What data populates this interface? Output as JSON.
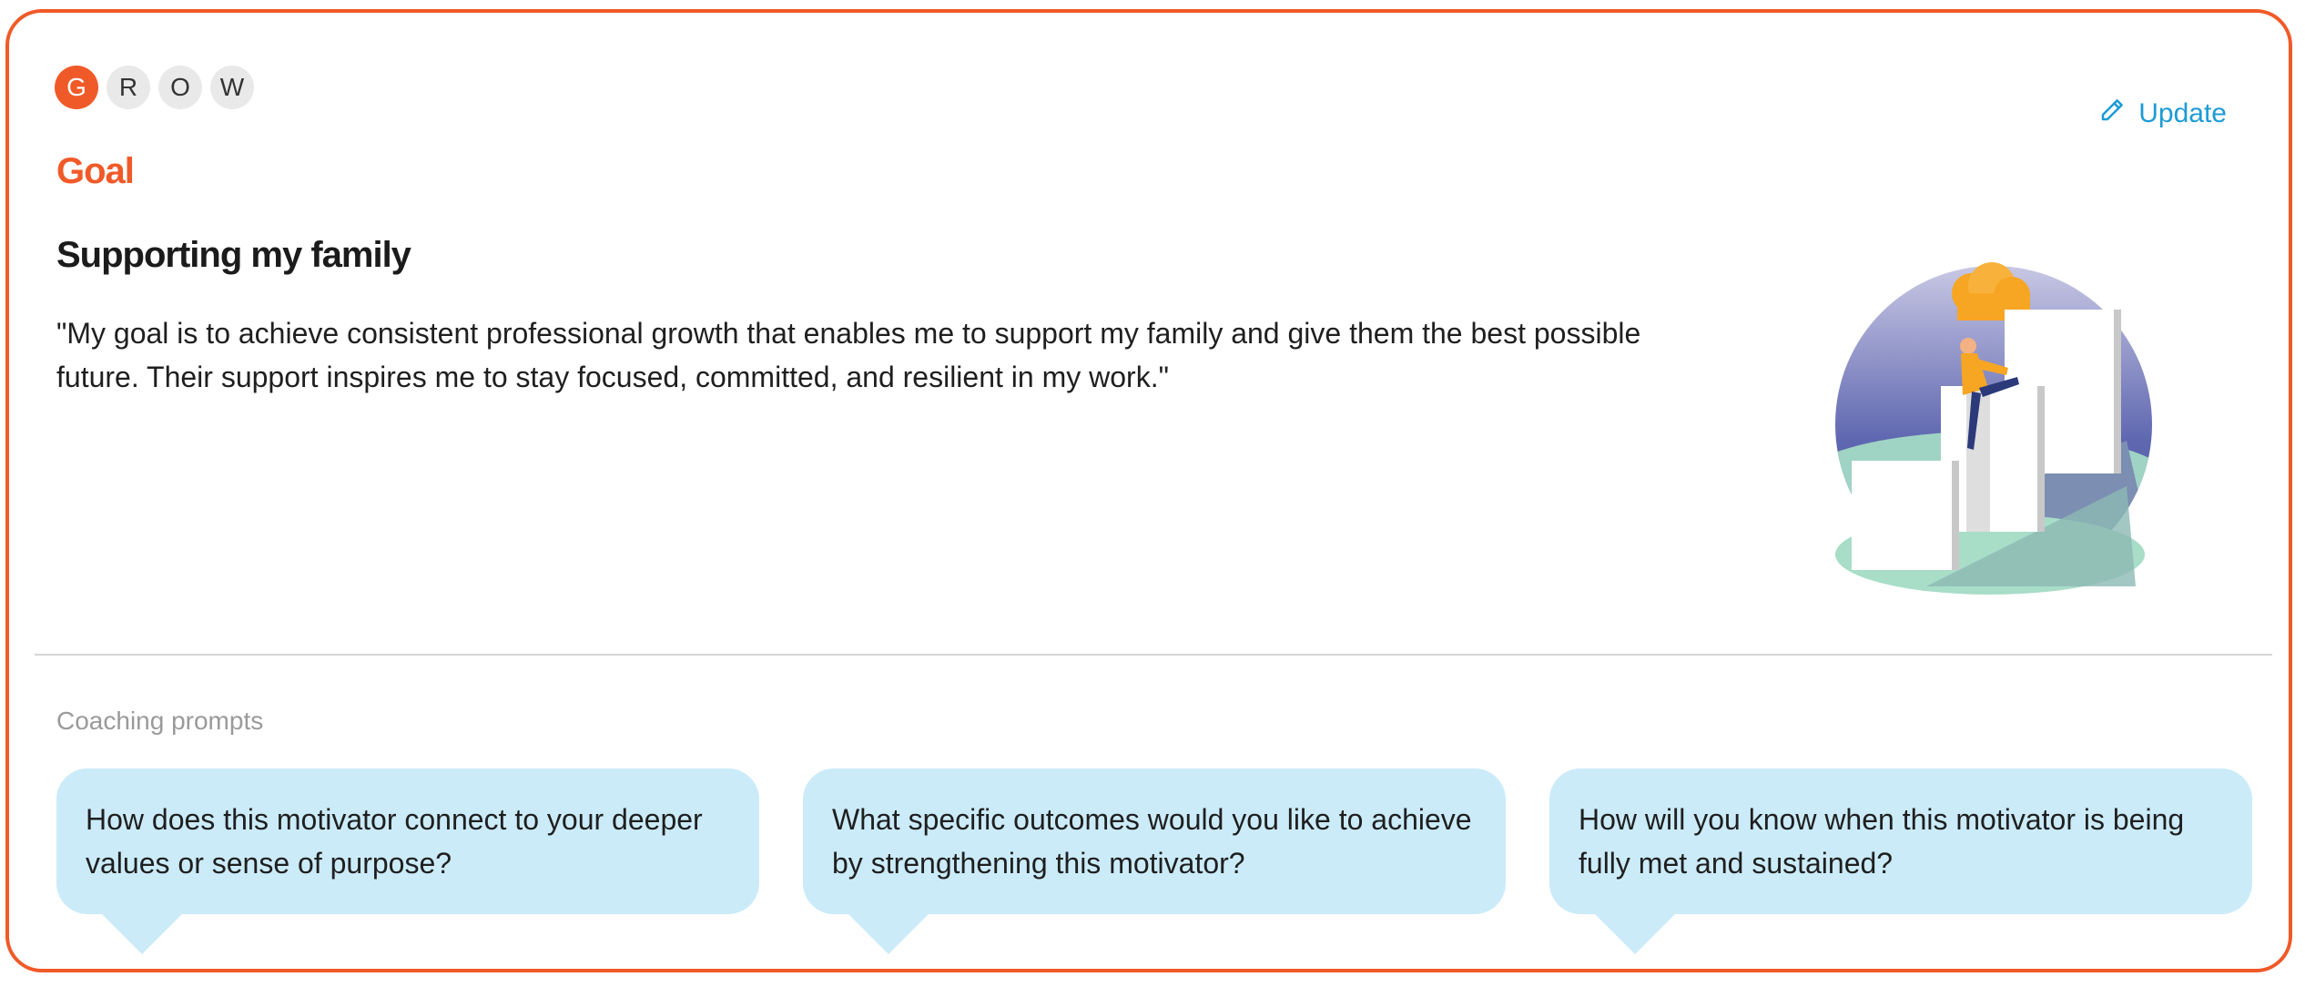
{
  "steps": [
    {
      "letter": "G",
      "active": true
    },
    {
      "letter": "R",
      "active": false
    },
    {
      "letter": "O",
      "active": false
    },
    {
      "letter": "W",
      "active": false
    }
  ],
  "section_title": "Goal",
  "update_label": "Update",
  "goal": {
    "title": "Supporting my family",
    "description": "\"My goal is to achieve consistent professional growth that enables me to support my family and give them the best possible future. Their support inspires me to stay focused, committed, and resilient in my work.\""
  },
  "prompts_label": "Coaching prompts",
  "prompts": [
    "How does this motivator connect to your deeper values or sense of purpose?",
    "What specific outcomes would you like to achieve by strengthening this motivator?",
    "How will you know when this motivator is being fully met and sustained?"
  ],
  "colors": {
    "accent": "#f05a28",
    "link": "#1d9bd6",
    "bubble": "#cbebf9"
  },
  "icons": {
    "update": "pencil-icon"
  }
}
